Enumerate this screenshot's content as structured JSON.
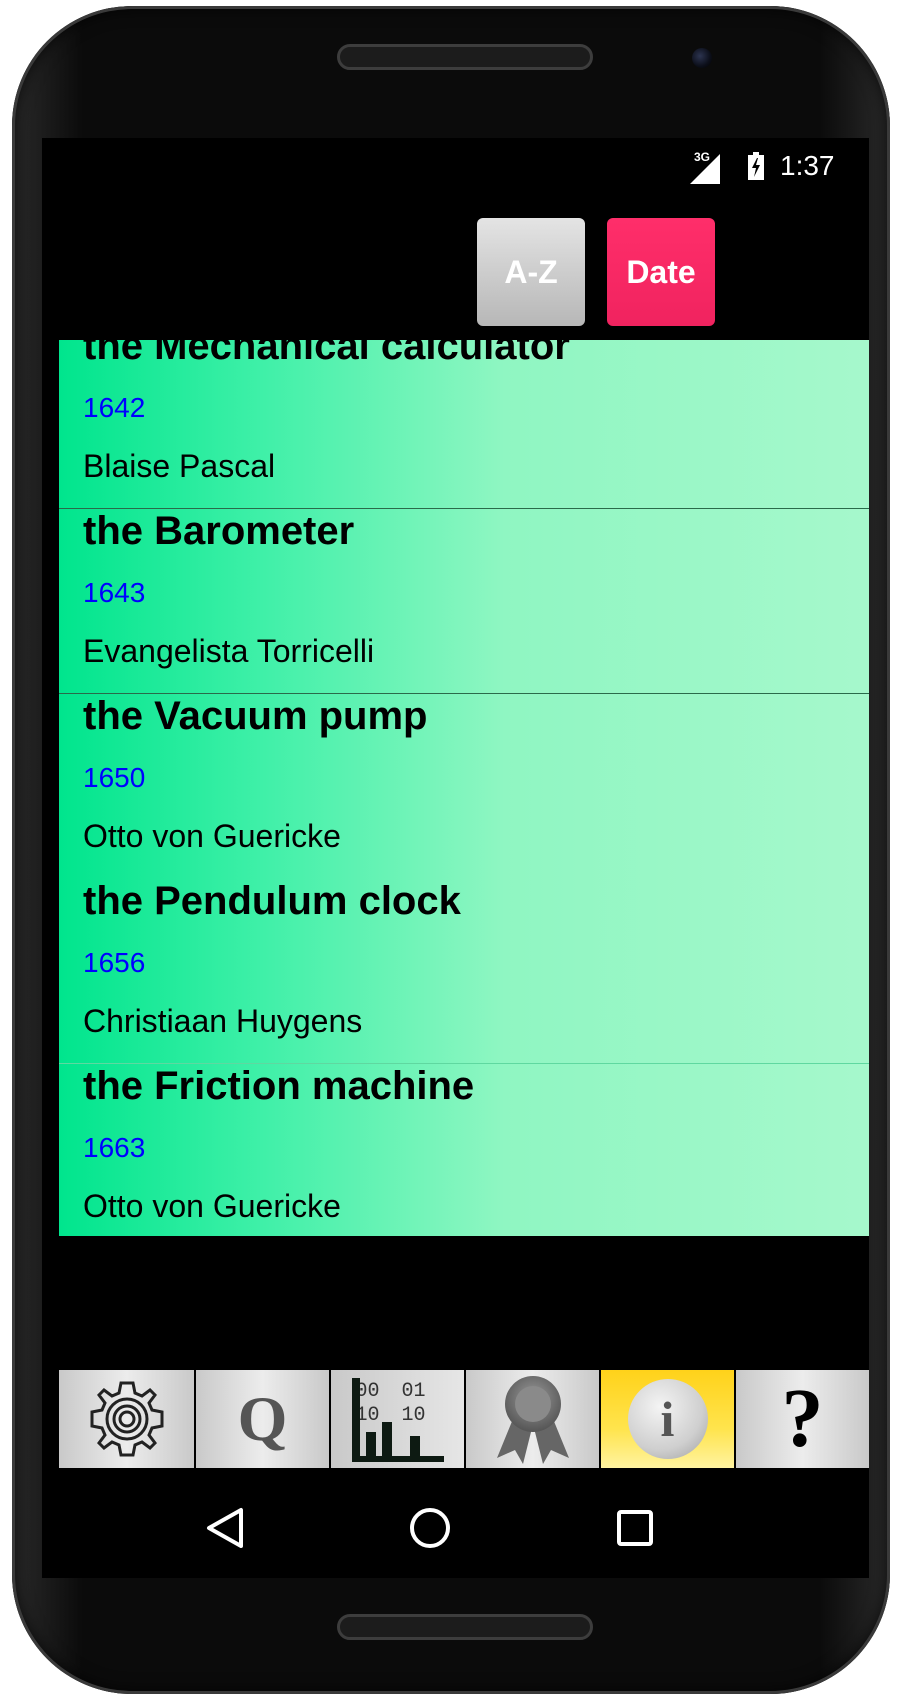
{
  "status_bar": {
    "network": "3G",
    "time": "1:37"
  },
  "sort_buttons": {
    "az_label": "A-Z",
    "date_label": "Date",
    "active": "Date"
  },
  "inventions": [
    {
      "name": "the Mechanical calculator",
      "year": "1642",
      "inventor": "Blaise Pascal"
    },
    {
      "name": "the Barometer",
      "year": "1643",
      "inventor": "Evangelista Torricelli"
    },
    {
      "name": "the Vacuum pump",
      "year": "1650",
      "inventor": "Otto von Guericke"
    },
    {
      "name": "the Pendulum clock",
      "year": "1656",
      "inventor": "Christiaan Huygens"
    },
    {
      "name": "the Friction machine",
      "year": "1663",
      "inventor": "Otto von Guericke"
    }
  ],
  "toolbar": {
    "items": [
      {
        "icon": "gear-icon"
      },
      {
        "icon": "quiz-q-icon",
        "glyph": "Q"
      },
      {
        "icon": "binary-stats-icon",
        "bits": [
          "00",
          "01",
          "10",
          "10"
        ]
      },
      {
        "icon": "award-ribbon-icon"
      },
      {
        "icon": "info-icon",
        "glyph": "i",
        "active": true
      },
      {
        "icon": "help-question-icon",
        "glyph": "?"
      }
    ]
  },
  "colors": {
    "list_gradient_start": "#00e58d",
    "list_gradient_end": "#a6f8cc",
    "year_text": "#0000ff",
    "date_button": "#f0235f",
    "active_tool": "#ffd21a"
  }
}
